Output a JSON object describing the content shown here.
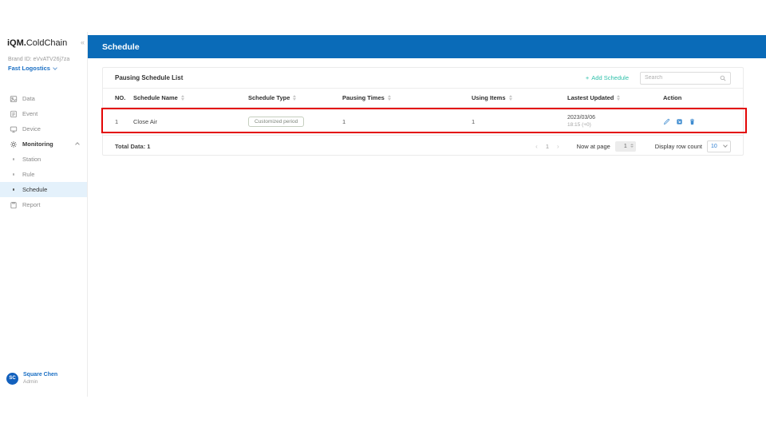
{
  "app": {
    "logo_bold": "iQM.",
    "logo_rest": "ColdChain"
  },
  "icons": {
    "collapse_glyph": "«",
    "plus_glyph": "+",
    "pager_prev_glyph": "‹",
    "pager_next_glyph": "›"
  },
  "sidebar": {
    "brand_id": "Brand ID: eVvATV26j7za",
    "org_name": "Fast Logostics",
    "items": [
      {
        "label": "Data"
      },
      {
        "label": "Event"
      },
      {
        "label": "Device"
      },
      {
        "label": "Monitoring"
      },
      {
        "label": "Station"
      },
      {
        "label": "Rule"
      },
      {
        "label": "Schedule"
      },
      {
        "label": "Report"
      }
    ],
    "user": {
      "initials": "SC",
      "name": "Square Chen",
      "role": "Admin"
    }
  },
  "header": {
    "title": "Schedule"
  },
  "panel": {
    "title": "Pausing Schedule List",
    "add_button": "Add Schedule",
    "search_placeholder": "Search",
    "columns": [
      "NO.",
      "Schedule Name",
      "Schedule Type",
      "Pausing Times",
      "Using Items",
      "Lastest Updated",
      "Action"
    ],
    "rows": [
      {
        "no": "1",
        "name": "Close Air",
        "type_badge": "Customized period",
        "pausing_times": "1",
        "using_items": "1",
        "updated_date": "2023/03/06",
        "updated_time": "18:15 (+0)"
      }
    ],
    "footer": {
      "total": "Total Data: 1",
      "page": "1",
      "now_at_page_label": "Now at page",
      "page_input_value": "1",
      "display_label": "Display row count",
      "row_count_value": "10"
    }
  },
  "colors": {
    "header_blue": "#0a6bb8",
    "accent_teal": "#2ec0aa",
    "action_blue": "#3f8cd0",
    "highlight_red": "#e30505",
    "active_item_bg": "#e4f1fb",
    "link_blue": "#1a6fc4"
  }
}
